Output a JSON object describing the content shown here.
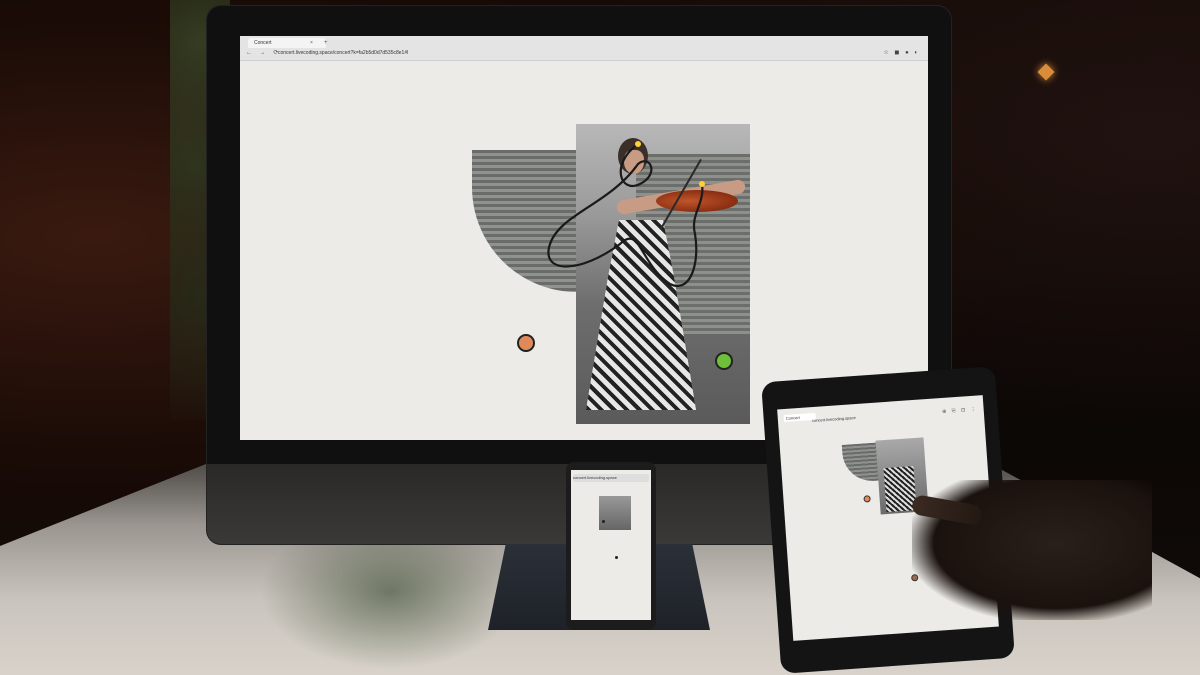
{
  "monitor": {
    "tab_title": "Concert",
    "tab_close": "×",
    "new_tab": "+",
    "nav_icons": "← → ⟳",
    "url": "concert.livecoding.space/concert?k=fa2b5d0d7d535c8e1#l",
    "ext_icons": "☆ ◼ ● ◐",
    "canvas": {
      "dots": [
        {
          "name": "orange-dot",
          "color": "#e08a5a"
        },
        {
          "name": "green-dot",
          "color": "#6fbf3b"
        }
      ]
    }
  },
  "phone": {
    "url": "concert.livecoding.space"
  },
  "tablet": {
    "status": "",
    "tab_title": "Concert",
    "url": "concert.livecoding.space",
    "icons": "⊕ ⎘ ⊡ ⋮"
  }
}
